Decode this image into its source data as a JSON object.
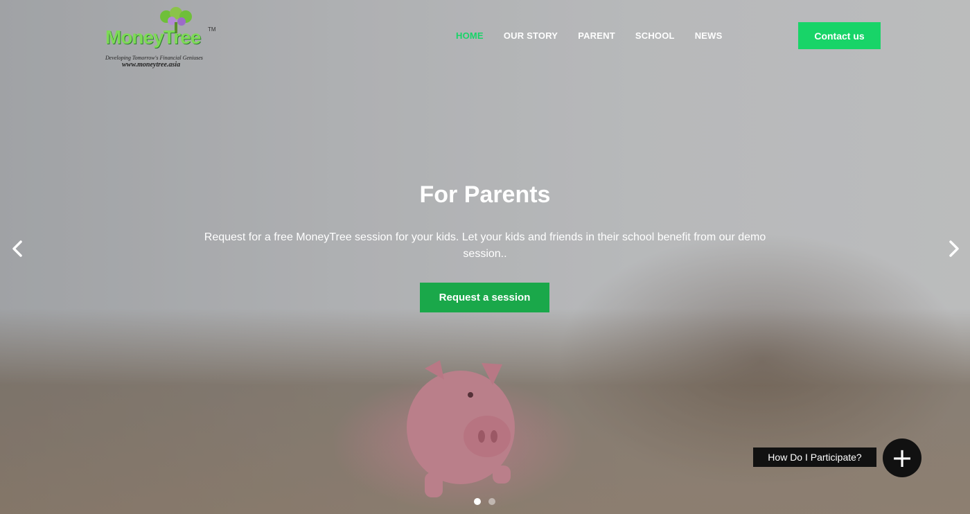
{
  "logo": {
    "brand": "MoneyTree",
    "trademark": "TM",
    "tagline": "Developing Tomorrow's Financial Geniuses",
    "url": "www.moneytree.asia"
  },
  "nav": {
    "items": [
      {
        "label": "HOME",
        "active": true
      },
      {
        "label": "OUR STORY",
        "active": false
      },
      {
        "label": "PARENT",
        "active": false
      },
      {
        "label": "SCHOOL",
        "active": false
      },
      {
        "label": "NEWS",
        "active": false
      }
    ],
    "contact_label": "Contact us"
  },
  "slider": {
    "title": "For Parents",
    "text": "Request for a free MoneyTree session for your kids. Let your kids and friends in their school benefit from our demo session..",
    "cta_label": "Request a session",
    "prev_icon": "chevron-left-icon",
    "next_icon": "chevron-right-icon",
    "current_slide": 1,
    "total_slides": 2
  },
  "help": {
    "label": "How Do I Participate?",
    "icon": "plus-icon"
  },
  "colors": {
    "accent": "#18d468",
    "cta": "#1aa84a",
    "dark": "#111111"
  }
}
